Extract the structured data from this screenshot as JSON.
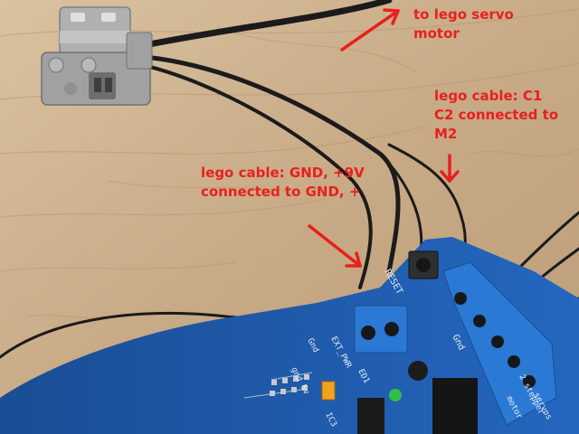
{
  "annotations": {
    "servo_line1": "to lego servo",
    "servo_line2": "motor",
    "c1c2_line1": "lego cable: C1",
    "c1c2_line2": "C2 connected to",
    "c1c2_line3": "M2",
    "gnd_line1": "lego cable: GND, +9V",
    "gnd_line2": "connected to GND, +"
  },
  "board_silkscreen": {
    "reset": "RESET",
    "ext_pwr": "EXT_PWR",
    "gnd": "Gnd",
    "gnd2": "Gnd",
    "gnd_5v": "gnd 5v",
    "stepper": "2 stepper",
    "motor": "motor",
    "servos": "servos",
    "ic3": "IC3",
    "ed1": "ED1"
  },
  "colors": {
    "annotation_red": "#e8201e",
    "wood": "#c9ad8a",
    "board_blue": "#1f5fb0",
    "terminal_blue": "#2a79d4",
    "lego_gray": "#a6a8aa",
    "red_wire": "#e86466",
    "black_wire": "#1b1b1b"
  }
}
